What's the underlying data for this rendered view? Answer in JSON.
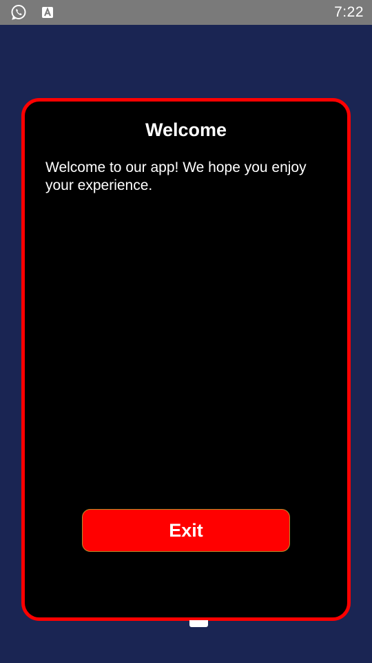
{
  "status_bar": {
    "time": "7:22",
    "icons": [
      "whatsapp-icon",
      "keyboard-a-icon"
    ]
  },
  "dialog": {
    "title": "Welcome",
    "message": "Welcome to our app! We hope you enjoy your experience.",
    "exit_label": "Exit"
  },
  "colors": {
    "background": "#1a2553",
    "status_bar": "#7a7a7a",
    "dialog_bg": "#000000",
    "accent": "#ff0000"
  }
}
